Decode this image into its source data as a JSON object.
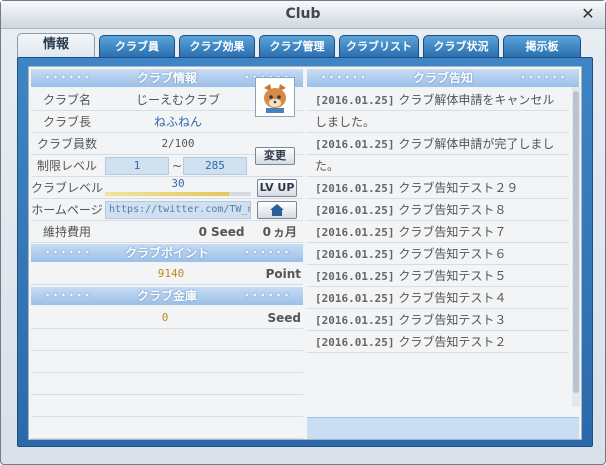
{
  "window": {
    "title": "Club",
    "close_glyph": "✕"
  },
  "tabs": [
    {
      "label": "情報",
      "active": true
    },
    {
      "label": "クラブ員"
    },
    {
      "label": "クラブ効果"
    },
    {
      "label": "クラブ管理"
    },
    {
      "label": "クラブリスト"
    },
    {
      "label": "クラブ状況"
    },
    {
      "label": "掲示板"
    }
  ],
  "info": {
    "header": "クラブ情報",
    "club_name_label": "クラブ名",
    "club_name": "じーえむクラブ",
    "leader_label": "クラブ長",
    "leader": "ねふねん",
    "members_label": "クラブ員数",
    "members": "2/100",
    "level_limit_label": "制限レベル",
    "level_min": "1",
    "level_sep": "~",
    "level_max": "285",
    "club_level_label": "クラブレベル",
    "club_level": "30",
    "club_level_progress": 0.85,
    "homepage_label": "ホームページ",
    "homepage": "https://twitter.com/TW_n",
    "fee_label": "維持費用",
    "fee_value": "0",
    "fee_unit": "Seed",
    "fee_months": "0",
    "fee_months_unit": "ヵ月",
    "change_button": "変更",
    "lvup_button": "LV UP",
    "home_icon": "home-icon"
  },
  "points": {
    "header": "クラブポイント",
    "value": "9140",
    "unit": "Point"
  },
  "treasury": {
    "header": "クラブ金庫",
    "value": "0",
    "unit": "Seed"
  },
  "notices": {
    "header": "クラブ告知",
    "items": [
      {
        "date": "[2016.01.25]",
        "text": "クラブ解体申請をキャンセル"
      },
      {
        "date": "",
        "text": "しました。"
      },
      {
        "date": "[2016.01.25]",
        "text": "クラブ解体申請が完了しまし"
      },
      {
        "date": "",
        "text": "た。"
      },
      {
        "date": "[2016.01.25]",
        "text": "クラブ告知テスト２９"
      },
      {
        "date": "[2016.01.25]",
        "text": "クラブ告知テスト８"
      },
      {
        "date": "[2016.01.25]",
        "text": "クラブ告知テスト７"
      },
      {
        "date": "[2016.01.25]",
        "text": "クラブ告知テスト６"
      },
      {
        "date": "[2016.01.25]",
        "text": "クラブ告知テスト５"
      },
      {
        "date": "[2016.01.25]",
        "text": "クラブ告知テスト４"
      },
      {
        "date": "[2016.01.25]",
        "text": "クラブ告知テスト３"
      },
      {
        "date": "[2016.01.25]",
        "text": "クラブ告知テスト２"
      }
    ]
  },
  "colors": {
    "accent": "#2b6aaa",
    "header_bg": "#9cc0e8",
    "link": "#3467a8"
  }
}
